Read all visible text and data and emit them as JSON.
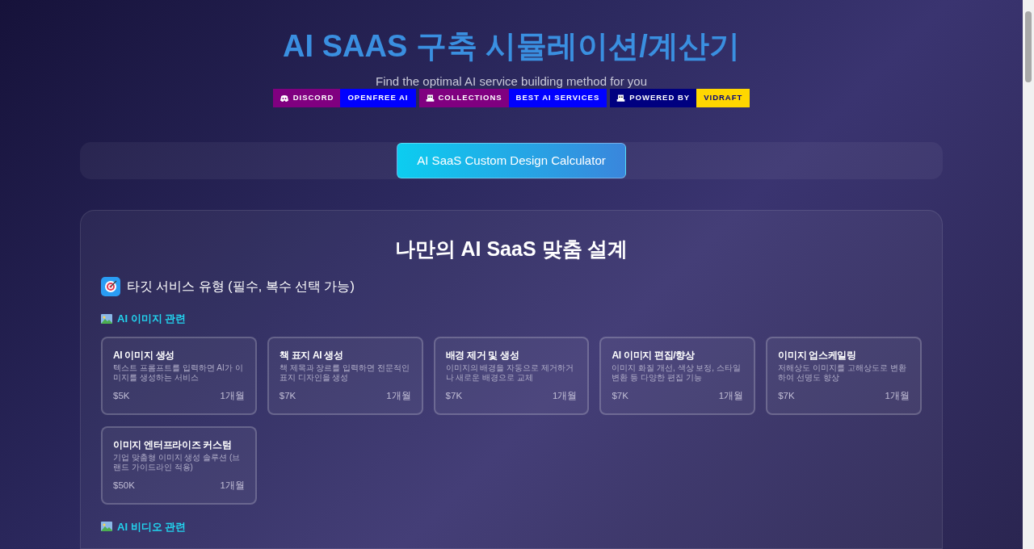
{
  "header": {
    "title": "AI SAAS 구축 시뮬레이션/계산기",
    "subtitle": "Find the optimal AI service building method for you",
    "badges": [
      {
        "label": "DISCORD",
        "value": "OPENFREE AI"
      },
      {
        "label": "COLLECTIONS",
        "value": "BEST AI SERVICES"
      },
      {
        "label": "POWERED BY",
        "value": "VIDRAFT"
      }
    ]
  },
  "toolbar": {
    "button": "AI SaaS Custom Design Calculator"
  },
  "designer": {
    "title": "나만의 AI SaaS 맞춤 설계",
    "section": "타깃 서비스 유형 (필수, 복수 선택 가능)",
    "categories": [
      {
        "title": "AI 이미지 관련",
        "services": [
          {
            "name": "AI 이미지 생성",
            "description": "텍스트 프롬프트를 입력하면 AI가 이미지를 생성하는 서비스",
            "price": "$5K",
            "duration": "1개월"
          },
          {
            "name": "책 표지 AI 생성",
            "description": "책 제목과 장르를 입력하면 전문적인 표지 디자인을 생성",
            "price": "$7K",
            "duration": "1개월"
          },
          {
            "name": "배경 제거 및 생성",
            "description": "이미지의 배경을 자동으로 제거하거나 새로운 배경으로 교체",
            "price": "$7K",
            "duration": "1개월"
          },
          {
            "name": "AI 이미지 편집/향상",
            "description": "이미지 화질 개선, 색상 보정, 스타일 변환 등 다양한 편집 기능",
            "price": "$7K",
            "duration": "1개월"
          },
          {
            "name": "이미지 업스케일링",
            "description": "저해상도 이미지를 고해상도로 변환하여 선명도 향상",
            "price": "$7K",
            "duration": "1개월"
          },
          {
            "name": "이미지 엔터프라이즈 커스텀",
            "description": "기업 맞춤형 이미지 생성 솔루션 (브랜드 가이드라인 적용)",
            "price": "$50K",
            "duration": "1개월"
          }
        ]
      },
      {
        "title": "AI 비디오 관련"
      }
    ]
  }
}
